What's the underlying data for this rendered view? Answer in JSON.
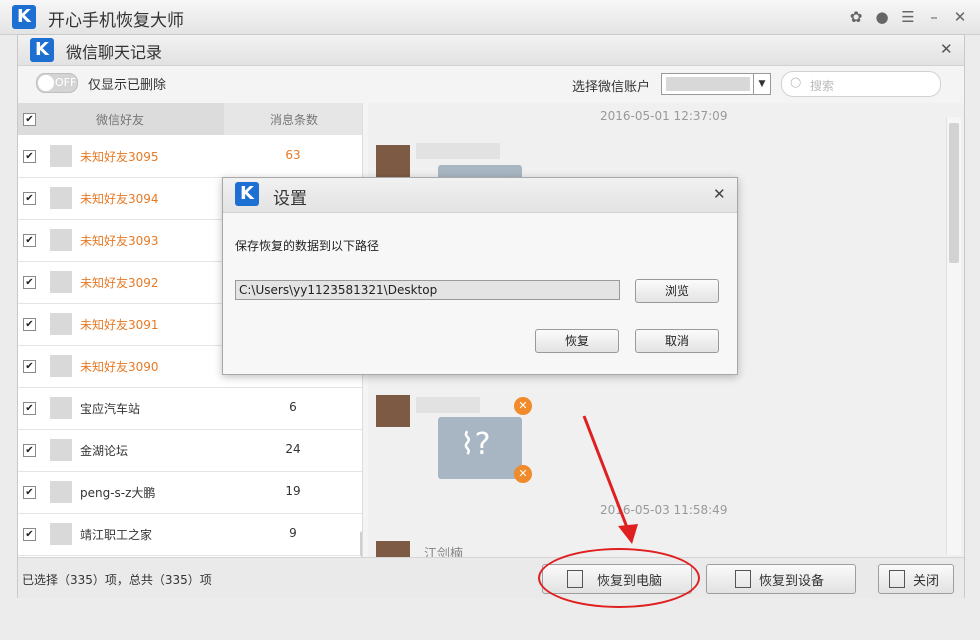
{
  "app": {
    "title": "开心手机恢复大师",
    "logo_letter": "K"
  },
  "window": {
    "title": "微信聊天记录",
    "logo_letter": "K"
  },
  "toolbar": {
    "toggle_text": "OFF",
    "only_deleted_label": "仅显示已删除",
    "account_label": "选择微信账户",
    "search_placeholder": "搜索"
  },
  "list": {
    "header_friend": "微信好友",
    "header_count": "消息条数",
    "rows": [
      {
        "name": "未知好友3095",
        "count": "63",
        "checked": true
      },
      {
        "name": "未知好友3094",
        "count": "",
        "checked": true
      },
      {
        "name": "未知好友3093",
        "count": "",
        "checked": true
      },
      {
        "name": "未知好友3092",
        "count": "",
        "checked": true
      },
      {
        "name": "未知好友3091",
        "count": "",
        "checked": true
      },
      {
        "name": "未知好友3090",
        "count": "",
        "checked": true
      },
      {
        "name": "宝应汽车站",
        "count": "6",
        "checked": true
      },
      {
        "name": "金湖论坛",
        "count": "24",
        "checked": true
      },
      {
        "name": "peng-s-z大鹏",
        "count": "19",
        "checked": true
      },
      {
        "name": "靖江职工之家",
        "count": "9",
        "checked": true
      }
    ]
  },
  "chat": {
    "timestamp1": "2016-05-01 12:37:09",
    "timestamp2": "2016-05-03 11:58:49",
    "sender3": "江剑楠"
  },
  "status": {
    "selection": "已选择（335）项，总共（335）项",
    "restore_pc": "恢复到电脑",
    "restore_device": "恢复到设备",
    "close": "关闭"
  },
  "dialog": {
    "title": "设置",
    "logo_letter": "K",
    "path_label": "保存恢复的数据到以下路径",
    "path_value": "C:\\Users\\yy1123581321\\Desktop",
    "browse": "浏览",
    "restore": "恢复",
    "cancel": "取消"
  },
  "colors": {
    "accent": "#1d6fd1",
    "unknown_friend": "#e77a26",
    "annotation": "#e02020"
  }
}
